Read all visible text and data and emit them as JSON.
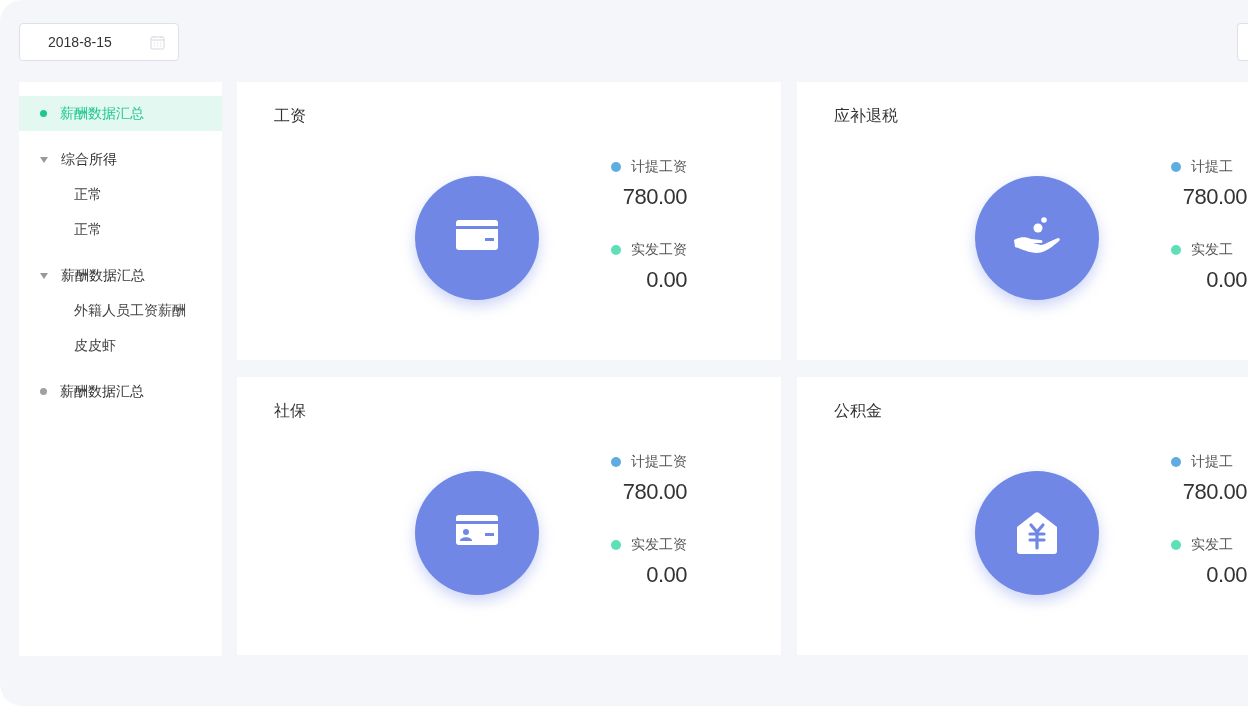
{
  "date_field": {
    "value": "2018-8-15"
  },
  "sidebar": {
    "items": [
      {
        "label": "薪酬数据汇总",
        "selected": true
      },
      {
        "label": "综合所得",
        "selected": false,
        "expanded": true,
        "children": [
          {
            "label": "正常",
            "selected": false
          },
          {
            "label": "正常",
            "selected": false
          }
        ]
      },
      {
        "label": "薪酬数据汇总",
        "selected": false,
        "expanded": true,
        "children": [
          {
            "label": "外籍人员工资薪酬",
            "selected": false
          },
          {
            "label": "皮皮虾",
            "selected": false
          }
        ]
      },
      {
        "label": "薪酬数据汇总",
        "selected": false
      }
    ]
  },
  "cards": [
    {
      "title": "工资",
      "metrics": [
        {
          "label": "计提工资",
          "value": "780.00",
          "color": "#5dade2"
        },
        {
          "label": "实发工资",
          "value": "0.00",
          "color": "#5ddfb8"
        }
      ]
    },
    {
      "title": "应补退税",
      "metrics": [
        {
          "label": "计提工",
          "value": "780.00",
          "color": "#5dade2"
        },
        {
          "label": "实发工",
          "value": "0.00",
          "color": "#5ddfb8"
        }
      ]
    },
    {
      "title": "社保",
      "metrics": [
        {
          "label": "计提工资",
          "value": "780.00",
          "color": "#5dade2"
        },
        {
          "label": "实发工资",
          "value": "0.00",
          "color": "#5ddfb8"
        }
      ]
    },
    {
      "title": "公积金",
      "metrics": [
        {
          "label": "计提工",
          "value": "780.00",
          "color": "#5dade2"
        },
        {
          "label": "实发工",
          "value": "0.00",
          "color": "#5ddfb8"
        }
      ]
    }
  ]
}
